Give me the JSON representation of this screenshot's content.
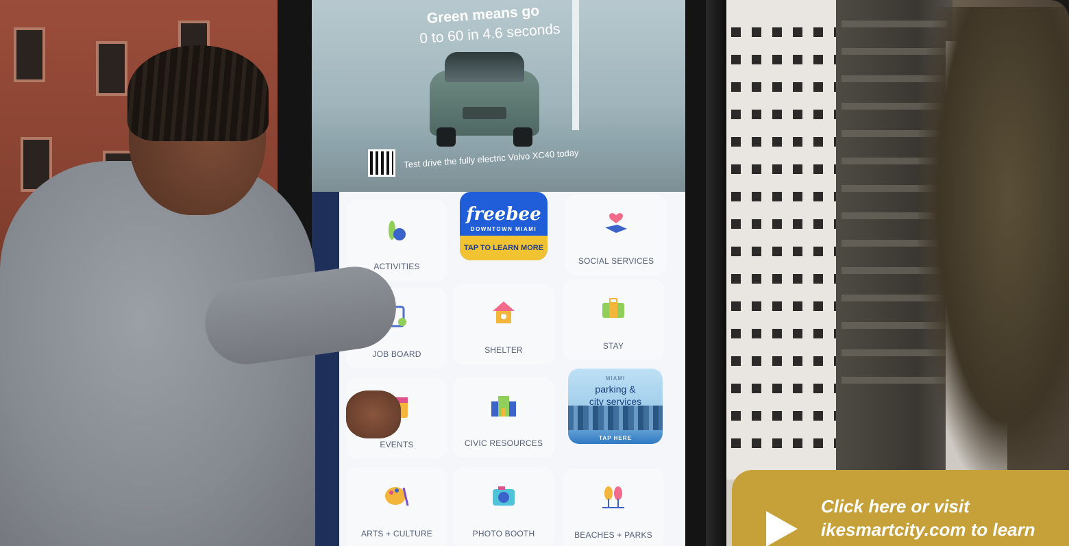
{
  "ad": {
    "headline": "Green means go",
    "subhead": "0 to 60 in 4.6 seconds",
    "cta": "Test drive the fully electric Volvo XC40 today"
  },
  "tiles": {
    "activities": "ACTIVITIES",
    "freebee_logo": "freebee",
    "freebee_sub": "DOWNTOWN MIAMI",
    "freebee_tap": "TAP TO LEARN MORE",
    "social_services": "SOCIAL SERVICES",
    "job_board": "JOB BOARD",
    "shelter": "SHELTER",
    "stay": "STAY",
    "events": "EVENTS",
    "civic_resources": "CIVIC RESOURCES",
    "parking_l1": "parking &",
    "parking_l2": "city services",
    "parking_tap": "TAP HERE",
    "arts_culture": "ARTS + CULTURE",
    "photo_booth": "PHOTO BOOTH",
    "beaches_parks": "BEACHES + PARKS"
  },
  "banner": {
    "line1": "Click here or visit",
    "line2": "ikesmartcity.com to learn"
  },
  "colors": {
    "banner": "#c6a13a",
    "freebee_blue": "#1f5ed8",
    "freebee_yellow": "#f1c232",
    "sidebar_navy": "#1e2f5a"
  }
}
